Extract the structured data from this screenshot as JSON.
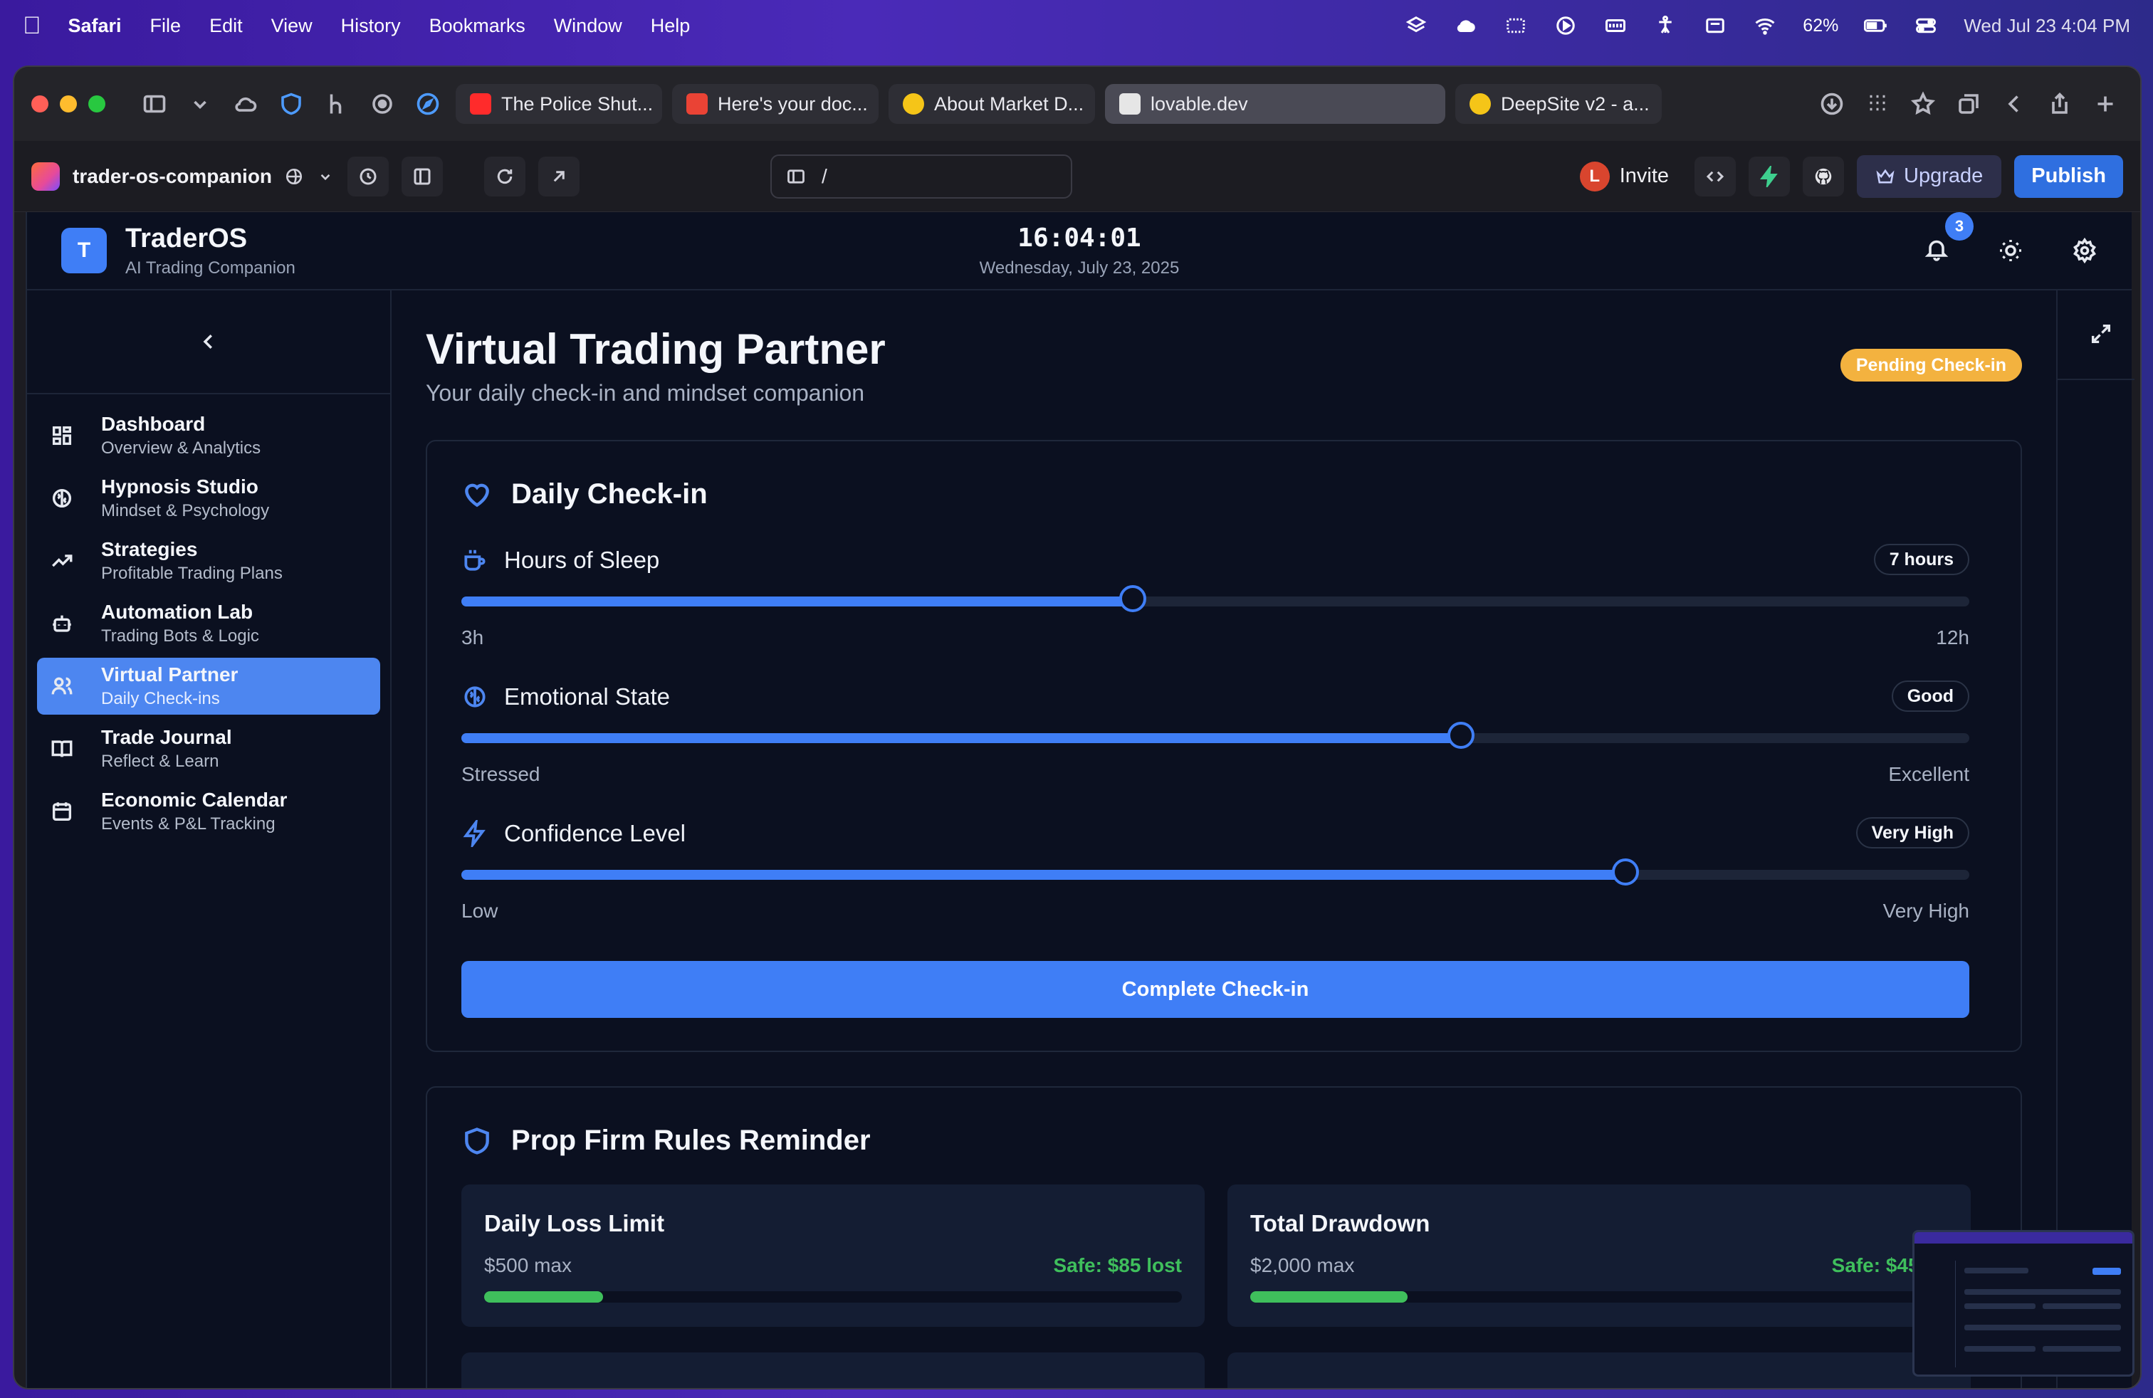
{
  "menubar": {
    "app": "Safari",
    "items": [
      "File",
      "Edit",
      "View",
      "History",
      "Bookmarks",
      "Window",
      "Help"
    ],
    "battery": "62%",
    "datetime": "Wed Jul 23  4:04 PM"
  },
  "browser": {
    "tabs": [
      {
        "label": "The Police Shut...",
        "favicon_color": "#ff2b2b"
      },
      {
        "label": "Here's your doc...",
        "favicon_color": "#ea4335"
      },
      {
        "label": "About Market D...",
        "favicon_color": "#f5c518"
      },
      {
        "label": "lovable.dev",
        "favicon_color": "#e6e6e6",
        "active": true
      },
      {
        "label": "DeepSite v2 - a...",
        "favicon_color": "#f5c518"
      }
    ]
  },
  "lovable": {
    "project": "trader-os-companion",
    "url_path": "/",
    "avatar_letter": "L",
    "invite": "Invite",
    "upgrade": "Upgrade",
    "publish": "Publish"
  },
  "app": {
    "brand_letter": "T",
    "brand_name": "TraderOS",
    "brand_sub": "AI Trading Companion",
    "time": "16:04:01",
    "date": "Wednesday, July 23, 2025",
    "notifications": "3",
    "nav": [
      {
        "title": "Dashboard",
        "sub": "Overview & Analytics",
        "icon": "grid-icon"
      },
      {
        "title": "Hypnosis Studio",
        "sub": "Mindset & Psychology",
        "icon": "brain-icon"
      },
      {
        "title": "Strategies",
        "sub": "Profitable Trading Plans",
        "icon": "trending-up-icon"
      },
      {
        "title": "Automation Lab",
        "sub": "Trading Bots & Logic",
        "icon": "bot-icon"
      },
      {
        "title": "Virtual Partner",
        "sub": "Daily Check-ins",
        "icon": "users-icon",
        "active": true
      },
      {
        "title": "Trade Journal",
        "sub": "Reflect & Learn",
        "icon": "book-icon"
      },
      {
        "title": "Economic Calendar",
        "sub": "Events & P&L Tracking",
        "icon": "calendar-icon"
      }
    ]
  },
  "page": {
    "title": "Virtual Trading Partner",
    "subtitle": "Your daily check-in and mindset companion",
    "status_badge": "Pending Check-in",
    "status_color": "#f3b23f",
    "checkin": {
      "title": "Daily Check-in",
      "sliders": [
        {
          "label": "Hours of Sleep",
          "value": "7 hours",
          "min": "3h",
          "max": "12h",
          "level": 0.445
        },
        {
          "label": "Emotional State",
          "value": "Good",
          "min": "Stressed",
          "max": "Excellent",
          "level": 0.663
        },
        {
          "label": "Confidence Level",
          "value": "Very High",
          "min": "Low",
          "max": "Very High",
          "level": 0.772
        }
      ],
      "button": "Complete Check-in"
    },
    "rules": {
      "title": "Prop Firm Rules Reminder",
      "items": [
        {
          "title": "Daily Loss Limit",
          "max": "$500 max",
          "status": "Safe: $85 lost",
          "level": 0.17
        },
        {
          "title": "Total Drawdown",
          "max": "$2,000 max",
          "status": "Safe: $450 d",
          "level": 0.225
        }
      ]
    }
  },
  "colors": {
    "accent": "#3f7ef6",
    "success": "#3fbf5c",
    "background": "#0b1020"
  }
}
